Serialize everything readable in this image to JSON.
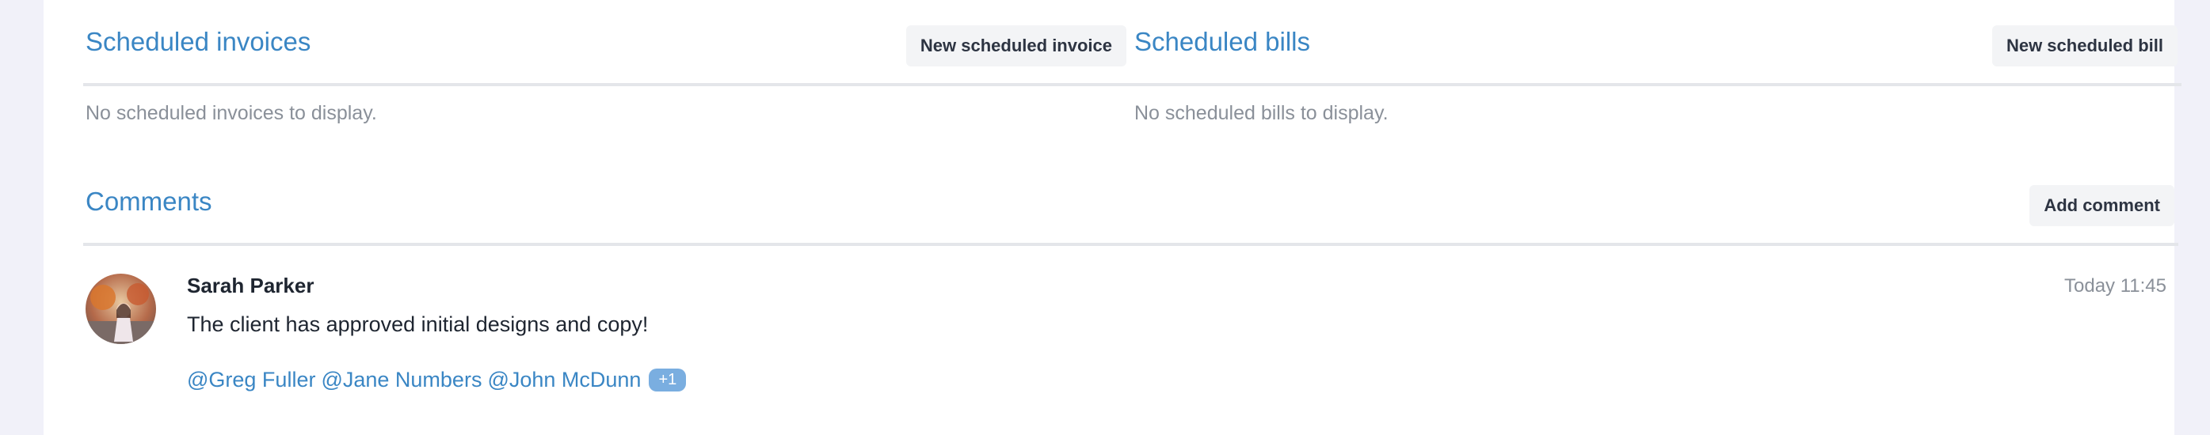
{
  "scheduled_invoices": {
    "title": "Scheduled invoices",
    "new_button_label": "New scheduled invoice",
    "empty_text": "No scheduled invoices to display."
  },
  "scheduled_bills": {
    "title": "Scheduled bills",
    "new_button_label": "New scheduled bill",
    "empty_text": "No scheduled bills to display."
  },
  "comments": {
    "title": "Comments",
    "add_button_label": "Add comment",
    "items": [
      {
        "author": "Sarah Parker",
        "timestamp": "Today 11:45",
        "text": "The client has approved initial designs and copy!",
        "mentions": [
          "@Greg Fuller",
          "@Jane Numbers",
          "@John McDunn"
        ],
        "more_mentions": "+1"
      }
    ]
  }
}
